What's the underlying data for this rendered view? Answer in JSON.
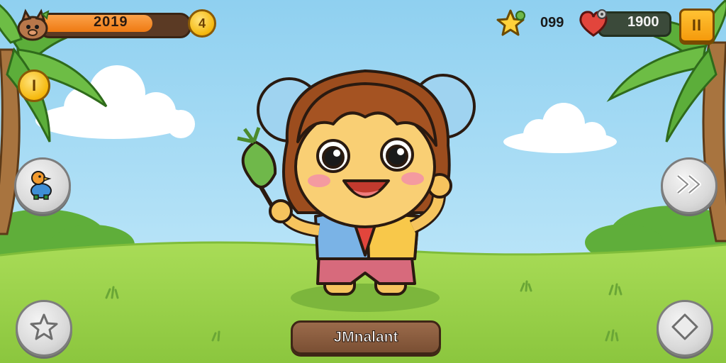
{
  "hud": {
    "xp_value": "2019",
    "xp_progress": 0.88,
    "level_badge": "4",
    "stars_value": "099",
    "hearts_value": "1900",
    "pause_symbol": "II",
    "side_coin_symbol": "I"
  },
  "character": {
    "name": "JMnalant"
  },
  "buttons": {
    "pet_icon": "pet-icon",
    "fast_forward_icon": "fast-forward-icon",
    "star_action_icon": "star-icon",
    "diamond_action_icon": "diamond-icon"
  },
  "colors": {
    "sky": "#9fd6f2",
    "grass": "#9fd453",
    "progress_fill": "#f7841e",
    "coin": "#f5b80c",
    "name_plate": "#8a5a3a"
  }
}
